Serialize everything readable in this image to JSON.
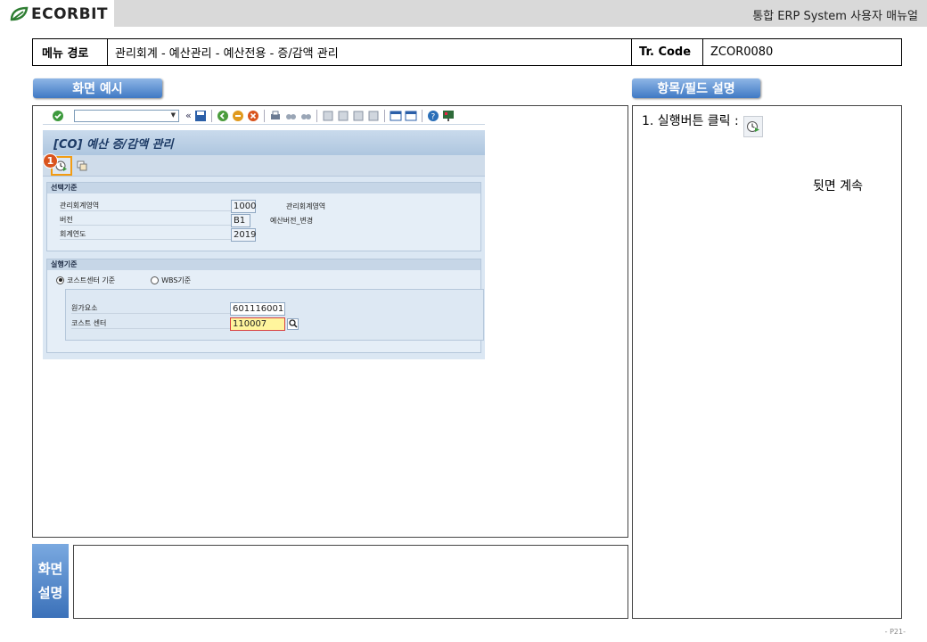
{
  "header": {
    "logo_text": "ECORBIT",
    "manual_title": "통합 ERP System 사용자 매뉴얼"
  },
  "menu_path": {
    "label": "메뉴 경로",
    "path": "관리회계 - 예산관리 - 예산전용 - 증/감액 관리",
    "tcode_label": "Tr. Code",
    "tcode": "ZCOR0080"
  },
  "sections": {
    "screen_example": "화면 예시",
    "field_description": "항목/필드 설명",
    "screen_desc_line1": "화면",
    "screen_desc_line2": "설명"
  },
  "field_notes": {
    "step1": "1.  실행버튼 클릭 :",
    "step1_cont": "뒷면 계속"
  },
  "sap": {
    "title": "[CO] 예산 증/감액 관리",
    "marker": "1",
    "group1": {
      "title": "선택기준",
      "rows": [
        {
          "label": "관리회계영역",
          "value": "1000",
          "desc": "관리회계영역"
        },
        {
          "label": "버전",
          "value": "B1",
          "desc": "예산버전_변경"
        },
        {
          "label": "회계연도",
          "value": "2019",
          "desc": ""
        }
      ]
    },
    "group2": {
      "title": "실행기준",
      "radio1": "코스트센터 기준",
      "radio2": "WBS기준",
      "rows": [
        {
          "label": "원가요소",
          "value": "601116001"
        },
        {
          "label": "코스트 센터",
          "value": "110007"
        }
      ]
    }
  },
  "page": "- P21-",
  "colors": {
    "tab_top": "#8fb6e6",
    "tab_bottom": "#3f79c4",
    "highlight": "#f39c12",
    "marker": "#d9541e"
  }
}
